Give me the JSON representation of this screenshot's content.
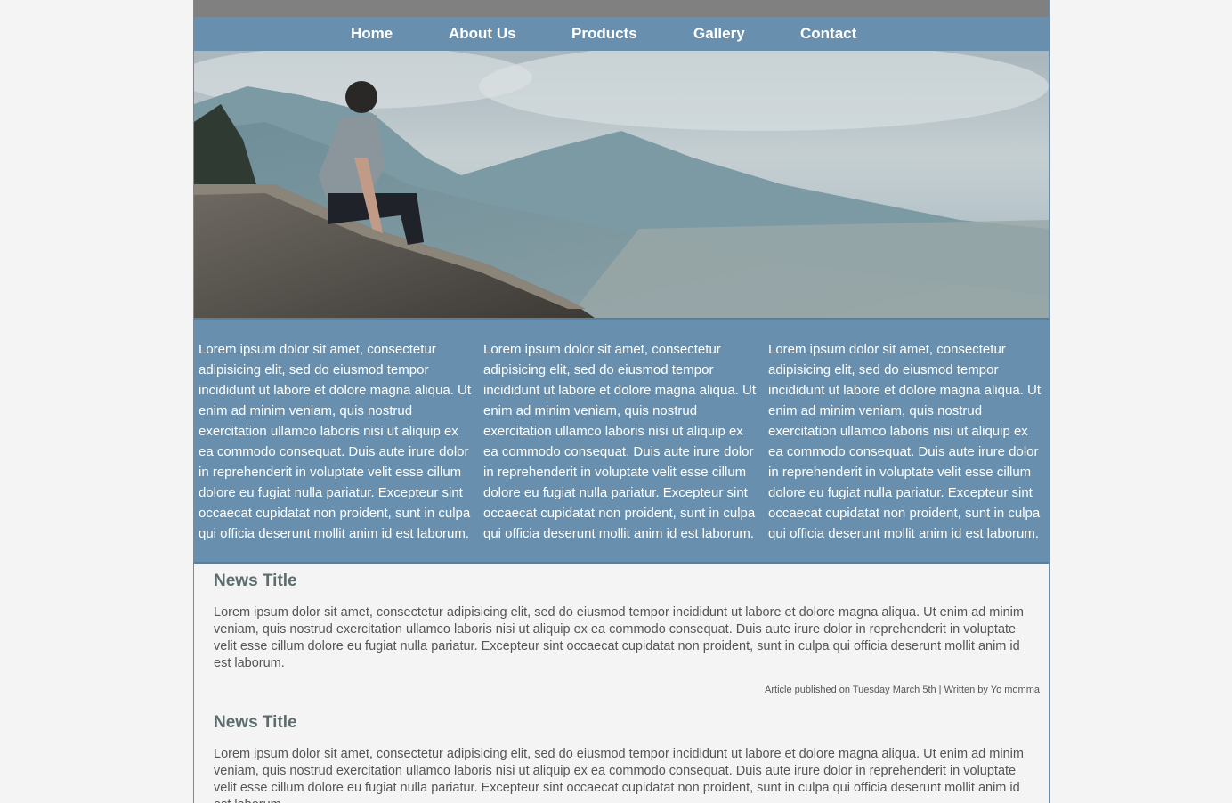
{
  "nav": {
    "items": [
      {
        "label": "Home"
      },
      {
        "label": "About Us"
      },
      {
        "label": "Products"
      },
      {
        "label": "Gallery"
      },
      {
        "label": "Contact"
      }
    ]
  },
  "hero": {
    "image": "man-sitting-on-wall-overlooking-valley"
  },
  "columns": [
    {
      "text": "Lorem ipsum dolor sit amet, consectetur adipisicing elit, sed do eiusmod tempor incididunt ut labore et dolore magna aliqua. Ut enim ad minim veniam, quis nostrud exercitation ullamco laboris nisi ut aliquip ex ea commodo consequat. Duis aute irure dolor in reprehenderit in voluptate velit esse cillum dolore eu fugiat nulla pariatur. Excepteur sint occaecat cupidatat non proident, sunt in culpa qui officia deserunt mollit anim id est laborum."
    },
    {
      "text": "Lorem ipsum dolor sit amet, consectetur adipisicing elit, sed do eiusmod tempor incididunt ut labore et dolore magna aliqua. Ut enim ad minim veniam, quis nostrud exercitation ullamco laboris nisi ut aliquip ex ea commodo consequat. Duis aute irure dolor in reprehenderit in voluptate velit esse cillum dolore eu fugiat nulla pariatur. Excepteur sint occaecat cupidatat non proident, sunt in culpa qui officia deserunt mollit anim id est laborum."
    },
    {
      "text": "Lorem ipsum dolor sit amet, consectetur adipisicing elit, sed do eiusmod tempor incididunt ut labore et dolore magna aliqua. Ut enim ad minim veniam, quis nostrud exercitation ullamco laboris nisi ut aliquip ex ea commodo consequat. Duis aute irure dolor in reprehenderit in voluptate velit esse cillum dolore eu fugiat nulla pariatur. Excepteur sint occaecat cupidatat non proident, sunt in culpa qui officia deserunt mollit anim id est laborum."
    }
  ],
  "news": [
    {
      "title": "News Title",
      "body": "Lorem ipsum dolor sit amet, consectetur adipisicing elit, sed do eiusmod tempor incididunt ut labore et dolore magna aliqua. Ut enim ad minim veniam, quis nostrud exercitation ullamco laboris nisi ut aliquip ex ea commodo consequat. Duis aute irure dolor in reprehenderit in voluptate velit esse cillum dolore eu fugiat nulla pariatur. Excepteur sint occaecat cupidatat non proident, sunt in culpa qui officia deserunt mollit anim id est laborum.",
      "meta": "Article published on Tuesday March 5th | Written by Yo momma"
    },
    {
      "title": "News Title",
      "body": "Lorem ipsum dolor sit amet, consectetur adipisicing elit, sed do eiusmod tempor incididunt ut labore et dolore magna aliqua. Ut enim ad minim veniam, quis nostrud exercitation ullamco laboris nisi ut aliquip ex ea commodo consequat. Duis aute irure dolor in reprehenderit in voluptate velit esse cillum dolore eu fugiat nulla pariatur. Excepteur sint occaecat cupidatat non proident, sunt in culpa qui officia deserunt mollit anim id est laborum."
    }
  ],
  "colors": {
    "nav_bg": "#6890ae",
    "top_bar": "#808080",
    "page_bg": "#f4f4f4",
    "title_text": "#5d6d6f"
  }
}
